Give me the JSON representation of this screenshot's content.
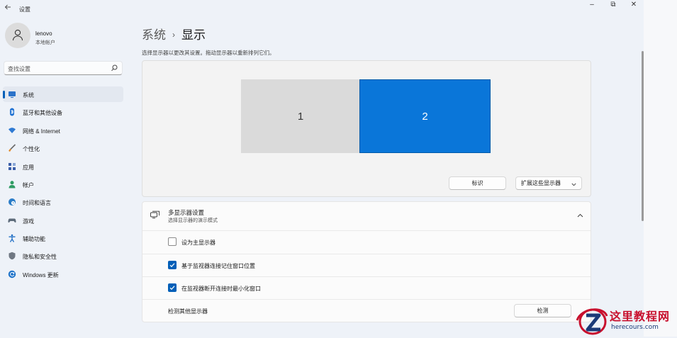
{
  "window": {
    "app_title": "设置",
    "back_icon": "back-arrow-icon",
    "minimize_glyph": "–",
    "restore_glyph": "⧉",
    "close_glyph": "✕"
  },
  "user": {
    "name": "lenovo",
    "account": "本地帐户",
    "avatar_icon": "person-icon"
  },
  "search": {
    "placeholder": "查找设置",
    "icon": "search-icon"
  },
  "sidebar": {
    "selected_index": 0,
    "accent": "#005fb8",
    "items": [
      {
        "label": "系统",
        "icon": "monitor-icon"
      },
      {
        "label": "蓝牙和其他设备",
        "icon": "bluetooth-icon"
      },
      {
        "label": "网络 & Internet",
        "icon": "wifi-icon"
      },
      {
        "label": "个性化",
        "icon": "brush-icon"
      },
      {
        "label": "应用",
        "icon": "apps-icon"
      },
      {
        "label": "帐户",
        "icon": "account-icon"
      },
      {
        "label": "时间和语言",
        "icon": "globe-clock-icon"
      },
      {
        "label": "游戏",
        "icon": "gamepad-icon"
      },
      {
        "label": "辅助功能",
        "icon": "accessibility-icon"
      },
      {
        "label": "隐私和安全性",
        "icon": "shield-icon"
      },
      {
        "label": "Windows 更新",
        "icon": "update-icon"
      }
    ]
  },
  "breadcrumb": {
    "parent": "系统",
    "separator": "›",
    "current": "显示"
  },
  "display_arrangement": {
    "hint": "选择显示器以更改其设置。拖动显示器以重新排列它们。",
    "monitors": [
      {
        "number": "1",
        "selected": false,
        "color": "#dadada"
      },
      {
        "number": "2",
        "selected": true,
        "color": "#0a76d9"
      }
    ],
    "identify_button": "标识",
    "mode_dropdown": "扩展这些显示器"
  },
  "multi_display": {
    "title": "多显示器设置",
    "subtitle": "选择显示器的演示模式",
    "expanded": true,
    "options": [
      {
        "label": "设为主显示器",
        "checked": false
      },
      {
        "label": "基于监视器连接记住窗口位置",
        "checked": true
      },
      {
        "label": "在监视器断开连接时最小化窗口",
        "checked": true
      }
    ],
    "detect_label": "检测其他显示器",
    "detect_button": "检测"
  },
  "watermark": {
    "title": "这里教程网",
    "url": "herecours.com"
  }
}
